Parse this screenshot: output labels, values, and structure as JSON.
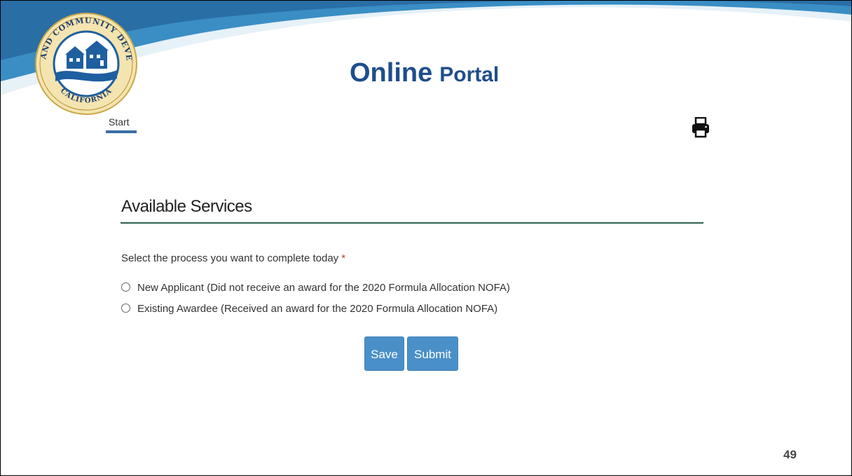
{
  "header": {
    "title_part1": "Online",
    "title_part2": "Portal",
    "seal": {
      "top_text": "HOUSING AND COMMUNITY DEVELOPMENT",
      "bottom_text": "CALIFORNIA",
      "icon": "houses-seal"
    }
  },
  "tabs": [
    {
      "label": "Start",
      "active": true
    }
  ],
  "toolbar": {
    "print_icon": "printer-icon"
  },
  "section": {
    "title": "Available Services"
  },
  "form": {
    "question": "Select the process you want to complete today",
    "required_mark": "*",
    "options": [
      {
        "label": "New Applicant (Did not receive an award for the 2020 Formula Allocation NOFA)",
        "selected": false
      },
      {
        "label": "Existing Awardee (Received an award for the 2020 Formula Allocation NOFA)",
        "selected": false
      }
    ],
    "save_label": "Save",
    "submit_label": "Submit"
  },
  "footer": {
    "page_number": "49"
  },
  "colors": {
    "title": "#1f4e8c",
    "button": "#4a90c8",
    "section_rule": "#2e5e52",
    "tab_underline": "#3a6ea5",
    "swoosh": "#3a8ec4",
    "required": "#c0392b"
  }
}
